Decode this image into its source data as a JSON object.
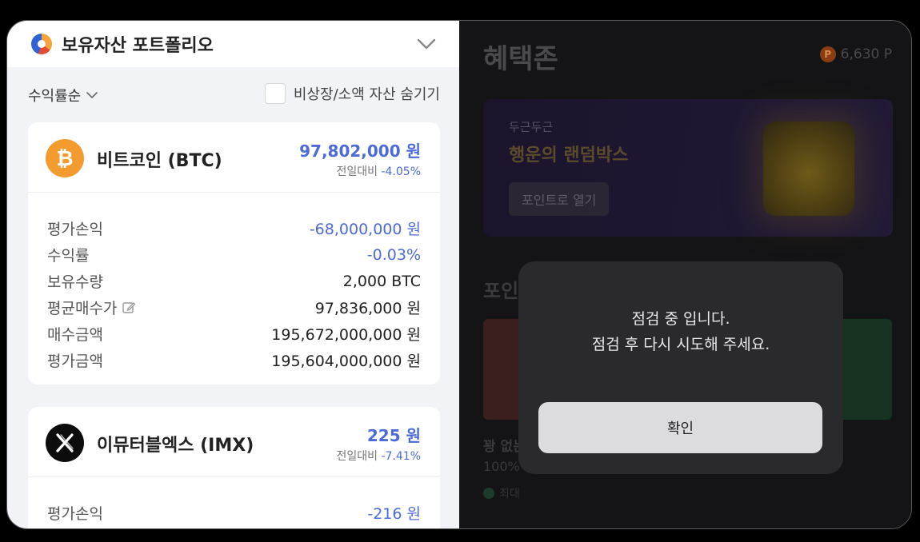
{
  "portfolio": {
    "title": "보유자산 포트폴리오",
    "sort_label": "수익률순",
    "hide_label": "비상장/소액 자산 숨기기",
    "coins": [
      {
        "name": "비트코인 (BTC)",
        "icon": "bitcoin-icon",
        "price": "97,802,000 원",
        "change_label": "전일대비",
        "change_pct": "-4.05%",
        "rows": [
          {
            "label": "평가손익",
            "value": "-68,000,000 원"
          },
          {
            "label": "수익률",
            "value": "-0.03%"
          },
          {
            "label": "보유수량",
            "value": "2,000 BTC"
          },
          {
            "label": "평균매수가",
            "value": "97,836,000 원"
          },
          {
            "label": "매수금액",
            "value": "195,672,000,000 원"
          },
          {
            "label": "평가금액",
            "value": "195,604,000,000 원"
          }
        ]
      },
      {
        "name": "이뮤터블엑스 (IMX)",
        "icon": "imx-icon",
        "price": "225 원",
        "change_label": "전일대비",
        "change_pct": "-7.41%",
        "rows": [
          {
            "label": "평가손익",
            "value": "-216 원"
          }
        ]
      }
    ]
  },
  "benefit": {
    "title": "혜택존",
    "points": "6,630 P",
    "point_badge": "P",
    "promo": {
      "subtitle": "두근두근",
      "title": "행운의 랜덤박스",
      "button": "포인트로 열기"
    },
    "section_title": "포인트 빌리",
    "ghost_line_1": "꽝 없는",
    "ghost_line_2": "100%",
    "ghost_line_3": "최대"
  },
  "modal": {
    "line1": "점검 중 입니다.",
    "line2": "점검 후 다시 시도해 주세요.",
    "confirm": "확인"
  },
  "colors": {
    "accent_blue": "#4d6bd8",
    "btc_orange": "#f39b2f"
  }
}
